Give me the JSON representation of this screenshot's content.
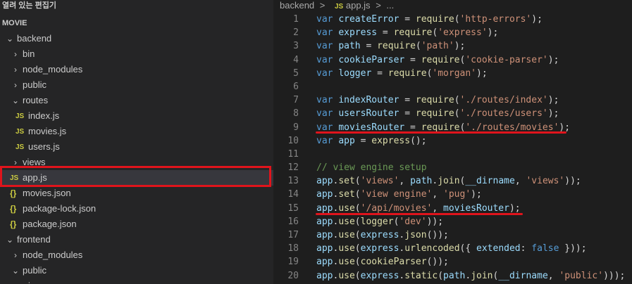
{
  "sidebar": {
    "title": "열려 있는 편집기",
    "section": "MOVIE",
    "items": [
      {
        "label": "backend",
        "kind": "folder",
        "expanded": true,
        "depth": 0
      },
      {
        "label": "bin",
        "kind": "folder",
        "expanded": false,
        "depth": 1
      },
      {
        "label": "node_modules",
        "kind": "folder",
        "expanded": false,
        "depth": 1
      },
      {
        "label": "public",
        "kind": "folder",
        "expanded": false,
        "depth": 1
      },
      {
        "label": "routes",
        "kind": "folder",
        "expanded": true,
        "depth": 1
      },
      {
        "label": "index.js",
        "kind": "js",
        "depth": 2
      },
      {
        "label": "movies.js",
        "kind": "js",
        "depth": 2
      },
      {
        "label": "users.js",
        "kind": "js",
        "depth": 2
      },
      {
        "label": "views",
        "kind": "folder",
        "expanded": false,
        "depth": 1
      },
      {
        "label": "app.js",
        "kind": "js",
        "depth": 1,
        "selected": true
      },
      {
        "label": "movies.json",
        "kind": "json",
        "depth": 1
      },
      {
        "label": "package-lock.json",
        "kind": "json",
        "depth": 1
      },
      {
        "label": "package.json",
        "kind": "json",
        "depth": 1
      },
      {
        "label": "frontend",
        "kind": "folder",
        "expanded": true,
        "depth": 0
      },
      {
        "label": "node_modules",
        "kind": "folder",
        "expanded": false,
        "depth": 1
      },
      {
        "label": "public",
        "kind": "folder",
        "expanded": true,
        "depth": 1
      },
      {
        "label": "img",
        "kind": "folder",
        "expanded": false,
        "depth": 2
      }
    ]
  },
  "icons": {
    "js": "JS",
    "json": "{}",
    "chevron_right": "›",
    "chevron_down": "⌄"
  },
  "breadcrumb": {
    "folder": "backend",
    "file_icon": "JS",
    "file": "app.js",
    "sep": ">",
    "more": "..."
  },
  "code": [
    {
      "n": "1",
      "t": [
        [
          "k",
          "var "
        ],
        [
          "v",
          "createError"
        ],
        [
          "p",
          " = "
        ],
        [
          "f",
          "require"
        ],
        [
          "p",
          "("
        ],
        [
          "s",
          "'http-errors'"
        ],
        [
          "p",
          ");"
        ]
      ]
    },
    {
      "n": "2",
      "t": [
        [
          "k",
          "var "
        ],
        [
          "v",
          "express"
        ],
        [
          "p",
          " = "
        ],
        [
          "f",
          "require"
        ],
        [
          "p",
          "("
        ],
        [
          "s",
          "'express'"
        ],
        [
          "p",
          ");"
        ]
      ]
    },
    {
      "n": "3",
      "t": [
        [
          "k",
          "var "
        ],
        [
          "v",
          "path"
        ],
        [
          "p",
          " = "
        ],
        [
          "f",
          "require"
        ],
        [
          "p",
          "("
        ],
        [
          "s",
          "'path'"
        ],
        [
          "p",
          ");"
        ]
      ]
    },
    {
      "n": "4",
      "t": [
        [
          "k",
          "var "
        ],
        [
          "v",
          "cookieParser"
        ],
        [
          "p",
          " = "
        ],
        [
          "f",
          "require"
        ],
        [
          "p",
          "("
        ],
        [
          "s",
          "'cookie-parser'"
        ],
        [
          "p",
          ");"
        ]
      ]
    },
    {
      "n": "5",
      "t": [
        [
          "k",
          "var "
        ],
        [
          "v",
          "logger"
        ],
        [
          "p",
          " = "
        ],
        [
          "f",
          "require"
        ],
        [
          "p",
          "("
        ],
        [
          "s",
          "'morgan'"
        ],
        [
          "p",
          ");"
        ]
      ]
    },
    {
      "n": "6",
      "t": []
    },
    {
      "n": "7",
      "t": [
        [
          "k",
          "var "
        ],
        [
          "v",
          "indexRouter"
        ],
        [
          "p",
          " = "
        ],
        [
          "f",
          "require"
        ],
        [
          "p",
          "("
        ],
        [
          "s",
          "'./routes/index'"
        ],
        [
          "p",
          ");"
        ]
      ]
    },
    {
      "n": "8",
      "t": [
        [
          "k",
          "var "
        ],
        [
          "v",
          "usersRouter"
        ],
        [
          "p",
          " = "
        ],
        [
          "f",
          "require"
        ],
        [
          "p",
          "("
        ],
        [
          "s",
          "'./routes/users'"
        ],
        [
          "p",
          ");"
        ]
      ]
    },
    {
      "n": "9",
      "t": [
        [
          "k",
          "var "
        ],
        [
          "v",
          "moviesRouter"
        ],
        [
          "p",
          " = "
        ],
        [
          "f",
          "require"
        ],
        [
          "p",
          "("
        ],
        [
          "s",
          "'./routes/movies'"
        ],
        [
          "p",
          ");"
        ]
      ]
    },
    {
      "n": "10",
      "t": [
        [
          "k",
          "var "
        ],
        [
          "v",
          "app"
        ],
        [
          "p",
          " = "
        ],
        [
          "f",
          "express"
        ],
        [
          "p",
          "();"
        ]
      ]
    },
    {
      "n": "11",
      "t": []
    },
    {
      "n": "12",
      "t": [
        [
          "c",
          "// view engine setup"
        ]
      ]
    },
    {
      "n": "13",
      "t": [
        [
          "v",
          "app"
        ],
        [
          "p",
          "."
        ],
        [
          "f",
          "set"
        ],
        [
          "p",
          "("
        ],
        [
          "s",
          "'views'"
        ],
        [
          "p",
          ", "
        ],
        [
          "v",
          "path"
        ],
        [
          "p",
          "."
        ],
        [
          "f",
          "join"
        ],
        [
          "p",
          "("
        ],
        [
          "v",
          "__dirname"
        ],
        [
          "p",
          ", "
        ],
        [
          "s",
          "'views'"
        ],
        [
          "p",
          "));"
        ]
      ]
    },
    {
      "n": "14",
      "t": [
        [
          "v",
          "app"
        ],
        [
          "p",
          "."
        ],
        [
          "f",
          "set"
        ],
        [
          "p",
          "("
        ],
        [
          "s",
          "'view engine'"
        ],
        [
          "p",
          ", "
        ],
        [
          "s",
          "'pug'"
        ],
        [
          "p",
          ");"
        ]
      ]
    },
    {
      "n": "15",
      "t": [
        [
          "v",
          "app"
        ],
        [
          "p",
          "."
        ],
        [
          "f",
          "use"
        ],
        [
          "p",
          "("
        ],
        [
          "s",
          "'/api/movies'"
        ],
        [
          "p",
          ", "
        ],
        [
          "v",
          "moviesRouter"
        ],
        [
          "p",
          ");"
        ]
      ]
    },
    {
      "n": "16",
      "t": [
        [
          "v",
          "app"
        ],
        [
          "p",
          "."
        ],
        [
          "f",
          "use"
        ],
        [
          "p",
          "("
        ],
        [
          "f",
          "logger"
        ],
        [
          "p",
          "("
        ],
        [
          "s",
          "'dev'"
        ],
        [
          "p",
          "));"
        ]
      ]
    },
    {
      "n": "17",
      "t": [
        [
          "v",
          "app"
        ],
        [
          "p",
          "."
        ],
        [
          "f",
          "use"
        ],
        [
          "p",
          "("
        ],
        [
          "v",
          "express"
        ],
        [
          "p",
          "."
        ],
        [
          "f",
          "json"
        ],
        [
          "p",
          "());"
        ]
      ]
    },
    {
      "n": "18",
      "t": [
        [
          "v",
          "app"
        ],
        [
          "p",
          "."
        ],
        [
          "f",
          "use"
        ],
        [
          "p",
          "("
        ],
        [
          "v",
          "express"
        ],
        [
          "p",
          "."
        ],
        [
          "f",
          "urlencoded"
        ],
        [
          "p",
          "({ "
        ],
        [
          "v",
          "extended"
        ],
        [
          "p",
          ": "
        ],
        [
          "k",
          "false"
        ],
        [
          "p",
          " }));"
        ]
      ]
    },
    {
      "n": "19",
      "t": [
        [
          "v",
          "app"
        ],
        [
          "p",
          "."
        ],
        [
          "f",
          "use"
        ],
        [
          "p",
          "("
        ],
        [
          "f",
          "cookieParser"
        ],
        [
          "p",
          "());"
        ]
      ]
    },
    {
      "n": "20",
      "t": [
        [
          "v",
          "app"
        ],
        [
          "p",
          "."
        ],
        [
          "f",
          "use"
        ],
        [
          "p",
          "("
        ],
        [
          "v",
          "express"
        ],
        [
          "p",
          "."
        ],
        [
          "f",
          "static"
        ],
        [
          "p",
          "("
        ],
        [
          "v",
          "path"
        ],
        [
          "p",
          "."
        ],
        [
          "f",
          "join"
        ],
        [
          "p",
          "("
        ],
        [
          "v",
          "__dirname"
        ],
        [
          "p",
          ", "
        ],
        [
          "s",
          "'public'"
        ],
        [
          "p",
          ")));"
        ]
      ]
    }
  ],
  "annotations": {
    "highlighted_file": "app.js",
    "underlined_lines": [
      "9",
      "15"
    ],
    "color": "#e0141c"
  },
  "colors": {
    "keyword": "#569cd6",
    "variable": "#9cdcfe",
    "function": "#dcdcaa",
    "string": "#ce9178",
    "comment": "#6a9955",
    "js_icon": "#cbcb41"
  }
}
